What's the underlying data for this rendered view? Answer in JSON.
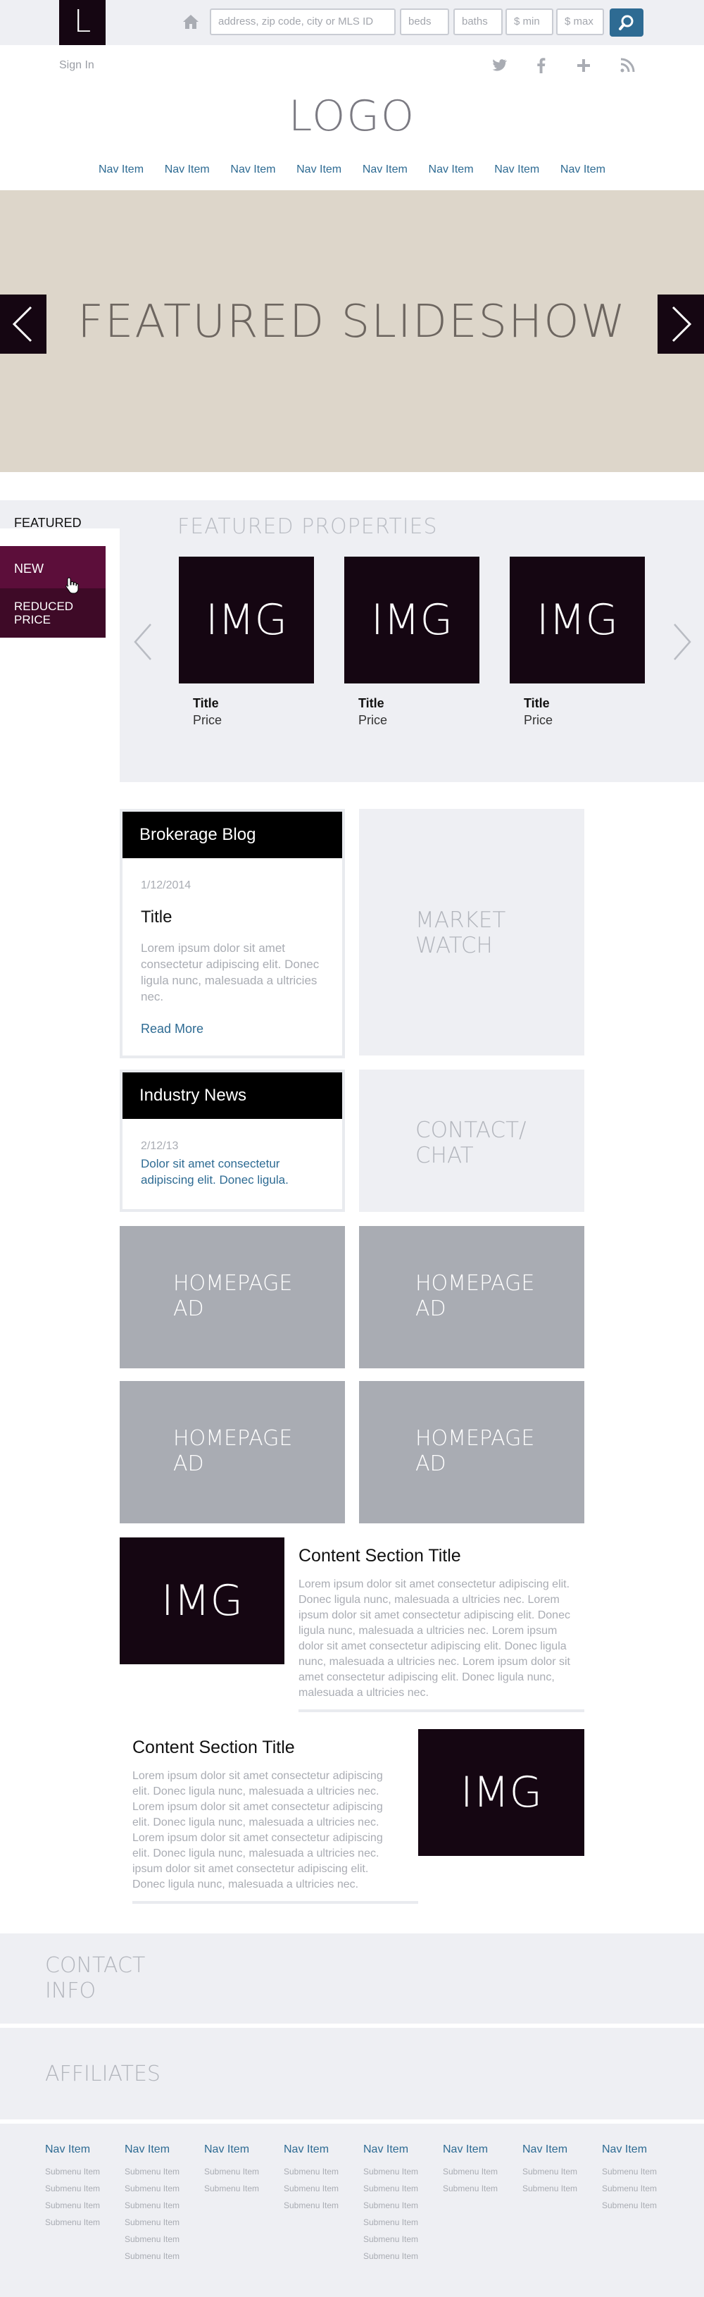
{
  "header": {
    "logo_letter": "L",
    "search": {
      "address_placeholder": "address, zip code, city or MLS ID",
      "beds_placeholder": "beds",
      "baths_placeholder": "baths",
      "min_placeholder": "$ min",
      "max_placeholder": "$ max"
    },
    "sign_in": "Sign In",
    "logo": "LOGO",
    "nav": [
      "Nav Item",
      "Nav Item",
      "Nav Item",
      "Nav Item",
      "Nav Item",
      "Nav Item",
      "Nav Item",
      "Nav Item"
    ]
  },
  "slideshow": {
    "title": "FEATURED SLIDESHOW"
  },
  "featured": {
    "tabs": {
      "featured": "FEATURED",
      "new": "NEW",
      "reduced": "REDUCED PRICE"
    },
    "title": "FEATURED PROPERTIES",
    "properties": [
      {
        "img": "IMG",
        "title": "Title",
        "price": "Price"
      },
      {
        "img": "IMG",
        "title": "Title",
        "price": "Price"
      },
      {
        "img": "IMG",
        "title": "Title",
        "price": "Price"
      }
    ]
  },
  "blog": {
    "heading": "Brokerage Blog",
    "date": "1/12/2014",
    "title": "Title",
    "body": "Lorem ipsum dolor sit amet consectetur adipiscing elit. Donec ligula nunc, malesuada a ultricies nec.",
    "read_more": "Read More"
  },
  "market_watch": "MARKET WATCH",
  "industry": {
    "heading": "Industry News",
    "date": "2/12/13",
    "link": "Dolor sit amet consectetur adipiscing elit. Donec ligula."
  },
  "contact_chat": "CONTACT/ CHAT",
  "ads": [
    "HOMEPAGE AD",
    "HOMEPAGE AD",
    "HOMEPAGE AD",
    "HOMEPAGE AD"
  ],
  "content_sections": [
    {
      "img": "IMG",
      "title": "Content Section Title",
      "body": "Lorem ipsum dolor sit amet consectetur adipiscing elit. Donec ligula nunc, malesuada a ultricies nec. Lorem ipsum dolor sit amet consectetur adipiscing elit. Donec ligula nunc, malesuada a ultricies nec. Lorem ipsum dolor sit amet consectetur adipiscing elit. Donec ligula nunc, malesuada a ultricies nec. Lorem ipsum dolor sit amet consectetur adipiscing elit. Donec ligula nunc, malesuada a ultricies nec."
    },
    {
      "img": "IMG",
      "title": "Content Section Title",
      "body": "Lorem ipsum dolor sit amet consectetur adipiscing elit. Donec ligula nunc, malesuada a ultricies nec. Lorem ipsum dolor sit amet consectetur adipiscing elit. Donec ligula nunc, malesuada a ultricies nec. Lorem ipsum dolor sit amet consectetur adipiscing elit. Donec ligula nunc, malesuada a ultricies nec. ipsum dolor sit amet consectetur adipiscing elit. Donec ligula nunc, malesuada a ultricies nec."
    }
  ],
  "contact_info": "CONTACT INFO",
  "affiliates": "AFFILIATES",
  "footer": {
    "columns": [
      {
        "head": "Nav Item",
        "items": [
          "Submenu Item",
          "Submenu Item",
          "Submenu Item",
          "Submenu Item"
        ]
      },
      {
        "head": "Nav Item",
        "items": [
          "Submenu Item",
          "Submenu Item",
          "Submenu Item",
          "Submenu Item",
          "Submenu Item",
          "Submenu Item"
        ]
      },
      {
        "head": "Nav Item",
        "items": [
          "Submenu Item",
          "Submenu Item"
        ]
      },
      {
        "head": "Nav Item",
        "items": [
          "Submenu Item",
          "Submenu Item",
          "Submenu Item"
        ]
      },
      {
        "head": "Nav Item",
        "items": [
          "Submenu Item",
          "Submenu Item",
          "Submenu Item",
          "Submenu Item",
          "Submenu Item",
          "Submenu Item"
        ]
      },
      {
        "head": "Nav Item",
        "items": [
          "Submenu Item",
          "Submenu Item"
        ]
      },
      {
        "head": "Nav Item",
        "items": [
          "Submenu Item",
          "Submenu Item"
        ]
      },
      {
        "head": "Nav Item",
        "items": [
          "Submenu Item",
          "Submenu Item",
          "Submenu Item"
        ]
      }
    ]
  },
  "colors": {
    "accent": "#2e6b93",
    "dark": "#150612",
    "ad_gray": "#a9acb3",
    "panel": "#eeeff3"
  }
}
